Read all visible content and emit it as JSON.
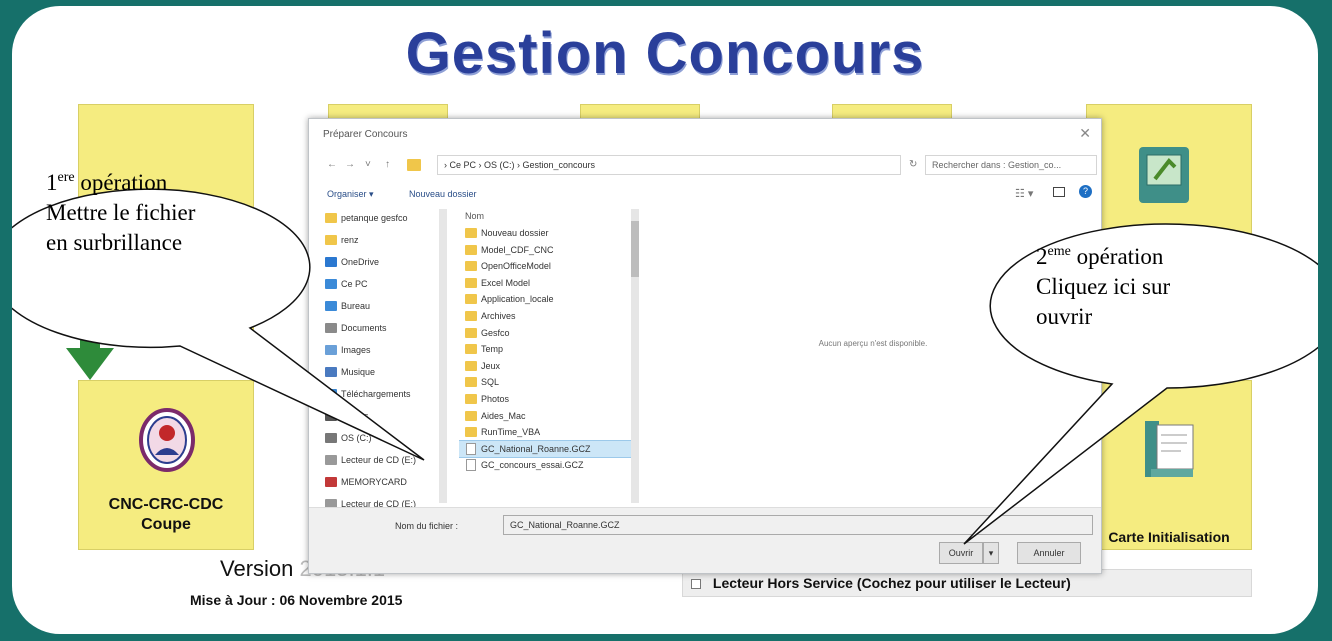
{
  "app": {
    "title": "Gestion Concours",
    "version_label": "Version",
    "version_value": "2015.1.1",
    "update_text": "Mise à Jour : 06 Novembre 2015",
    "reader_checkbox_label": "Lecteur Hors Service (Cochez pour utiliser le Lecteur)"
  },
  "tiles": {
    "left_label_line1": "CNC-CRC-CDC",
    "left_label_line2": "Coupe",
    "right_label": "Carte Initialisation"
  },
  "dialog": {
    "title": "Préparer Concours",
    "close": "✕",
    "breadcrumb": "› Ce PC › OS (C:) › Gestion_concours",
    "search_placeholder": "Rechercher dans : Gestion_co...",
    "organize": "Organiser ▾",
    "new_folder": "Nouveau dossier",
    "column_name": "Nom",
    "nav_tree": [
      {
        "label": "petanque gesfco",
        "icon": "folder"
      },
      {
        "label": "renz",
        "icon": "folder"
      },
      {
        "label": "OneDrive",
        "icon": "cloud"
      },
      {
        "label": "Ce PC",
        "icon": "pc"
      },
      {
        "label": "Bureau",
        "icon": "desktop"
      },
      {
        "label": "Documents",
        "icon": "documents"
      },
      {
        "label": "Images",
        "icon": "images"
      },
      {
        "label": "Musique",
        "icon": "music"
      },
      {
        "label": "Téléchargements",
        "icon": "downloads"
      },
      {
        "label": "Vidéos",
        "icon": "videos"
      },
      {
        "label": "OS (C:)",
        "icon": "drive"
      },
      {
        "label": "Lecteur de CD (E:)",
        "icon": "cd"
      },
      {
        "label": "MEMORYCARD",
        "icon": "card"
      },
      {
        "label": "Lecteur de CD (E:)",
        "icon": "cd"
      }
    ],
    "files": [
      {
        "label": "Nouveau dossier",
        "type": "folder"
      },
      {
        "label": "Model_CDF_CNC",
        "type": "folder"
      },
      {
        "label": "OpenOfficeModel",
        "type": "folder"
      },
      {
        "label": "Excel Model",
        "type": "folder"
      },
      {
        "label": "Application_locale",
        "type": "folder"
      },
      {
        "label": "Archives",
        "type": "folder"
      },
      {
        "label": "Gesfco",
        "type": "folder"
      },
      {
        "label": "Temp",
        "type": "folder"
      },
      {
        "label": "Jeux",
        "type": "folder"
      },
      {
        "label": "SQL",
        "type": "folder"
      },
      {
        "label": "Photos",
        "type": "folder"
      },
      {
        "label": "Aides_Mac",
        "type": "folder"
      },
      {
        "label": "RunTime_VBA",
        "type": "folder"
      },
      {
        "label": "GC_National_Roanne.GCZ",
        "type": "file",
        "selected": true
      },
      {
        "label": "GC_concours_essai.GCZ",
        "type": "file"
      }
    ],
    "preview_text": "Aucun aperçu n'est disponible.",
    "filename_label": "Nom du fichier :",
    "filename_value": "GC_National_Roanne.GCZ",
    "open_button": "Ouvrir",
    "cancel_button": "Annuler"
  },
  "callouts": {
    "first_num": "1",
    "first_sup": "ere",
    "first_line1_rest": " opération",
    "first_line2": "Mettre le fichier",
    "first_line3": "en surbrillance",
    "second_num": "2",
    "second_sup": "eme",
    "second_line1_rest": " opération",
    "second_line2": "Cliquez ici sur",
    "second_line3": "ouvrir"
  },
  "colors": {
    "frame": "#16706a",
    "title": "#2a3f9a",
    "tile": "#f5ec80",
    "selection": "#cce6f7",
    "arrow": "#2e8b3a"
  }
}
